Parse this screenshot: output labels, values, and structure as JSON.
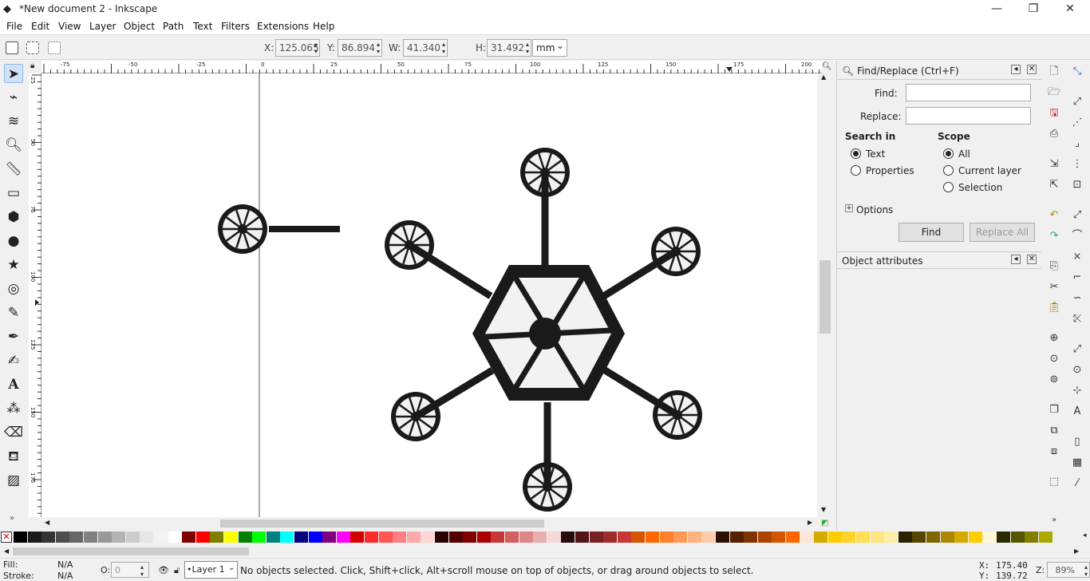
{
  "window": {
    "title": "*New document 2 - Inkscape",
    "minimize": "—",
    "maximize": "❐",
    "close": "✕"
  },
  "menu": [
    "File",
    "Edit",
    "View",
    "Layer",
    "Object",
    "Path",
    "Text",
    "Filters",
    "Extensions",
    "Help"
  ],
  "toolbar": {
    "x_label": "X:",
    "x_value": "125.065",
    "y_label": "Y:",
    "y_value": "86.894",
    "w_label": "W:",
    "w_value": "41.340",
    "h_label": "H:",
    "h_value": "31.492",
    "unit": "mm"
  },
  "ruler_top_labels": [
    "-75",
    "-50",
    "-25",
    "0",
    "25",
    "50",
    "75",
    "100",
    "125",
    "150",
    "175",
    "200"
  ],
  "ruler_left_labels": [
    "25",
    "50",
    "75",
    "100",
    "125",
    "150",
    "175",
    "200",
    "225"
  ],
  "find_replace": {
    "title": "Find/Replace (Ctrl+F)",
    "find_label": "Find:",
    "find_value": "",
    "replace_label": "Replace:",
    "replace_value": "",
    "search_in_title": "Search in",
    "search_in": [
      {
        "label": "Text",
        "selected": true
      },
      {
        "label": "Properties",
        "selected": false
      }
    ],
    "scope_title": "Scope",
    "scope": [
      {
        "label": "All",
        "selected": true
      },
      {
        "label": "Current layer",
        "selected": false
      },
      {
        "label": "Selection",
        "selected": false
      }
    ],
    "options_label": "Options",
    "find_button": "Find",
    "replace_all_button": "Replace All"
  },
  "object_attributes": {
    "title": "Object attributes"
  },
  "palette_colors": [
    "#000000",
    "#1a1a1a",
    "#333333",
    "#4d4d4d",
    "#666666",
    "#808080",
    "#999999",
    "#b3b3b3",
    "#cccccc",
    "#e6e6e6",
    "#f2f2f2",
    "#ffffff",
    "#800000",
    "#ff0000",
    "#808000",
    "#ffff00",
    "#008000",
    "#00ff00",
    "#008080",
    "#00ffff",
    "#000080",
    "#0000ff",
    "#800080",
    "#ff00ff",
    "#d40000",
    "#ff2a2a",
    "#ff5555",
    "#ff8080",
    "#ffaaaa",
    "#ffd5d5",
    "#2b0000",
    "#550000",
    "#800000",
    "#aa0000",
    "#c83737",
    "#d35f5f",
    "#de8787",
    "#e9afaf",
    "#f4d7d7",
    "#280b0b",
    "#501616",
    "#782121",
    "#a02c2c",
    "#c83737",
    "#d45500",
    "#ff6600",
    "#ff7f2a",
    "#ff9955",
    "#ffb380",
    "#ffccaa",
    "#2b1100",
    "#552200",
    "#803300",
    "#aa4400",
    "#d45500",
    "#ff6600",
    "#ffe6d5",
    "#d4aa00",
    "#ffcc00",
    "#ffd42a",
    "#ffdd55",
    "#ffe680",
    "#ffeeaa",
    "#2b2200",
    "#554400",
    "#806600",
    "#aa8800",
    "#d4aa00",
    "#ffcc00",
    "#fff6d5",
    "#2b2b00",
    "#555500",
    "#808000",
    "#aaaa00"
  ],
  "status": {
    "fill_label": "Fill:",
    "fill_value": "N/A",
    "stroke_label": "Stroke:",
    "stroke_value": "N/A",
    "opacity_label": "O:",
    "opacity_value": "0",
    "layer": "•Layer 1",
    "message": "No objects selected. Click, Shift+click, Alt+scroll mouse on top of objects, or drag around objects to select.",
    "x_label": "X:",
    "x_value": "175.40",
    "y_label": "Y:",
    "y_value": "139.72",
    "zoom_label": "Z:",
    "zoom_value": "89%"
  }
}
